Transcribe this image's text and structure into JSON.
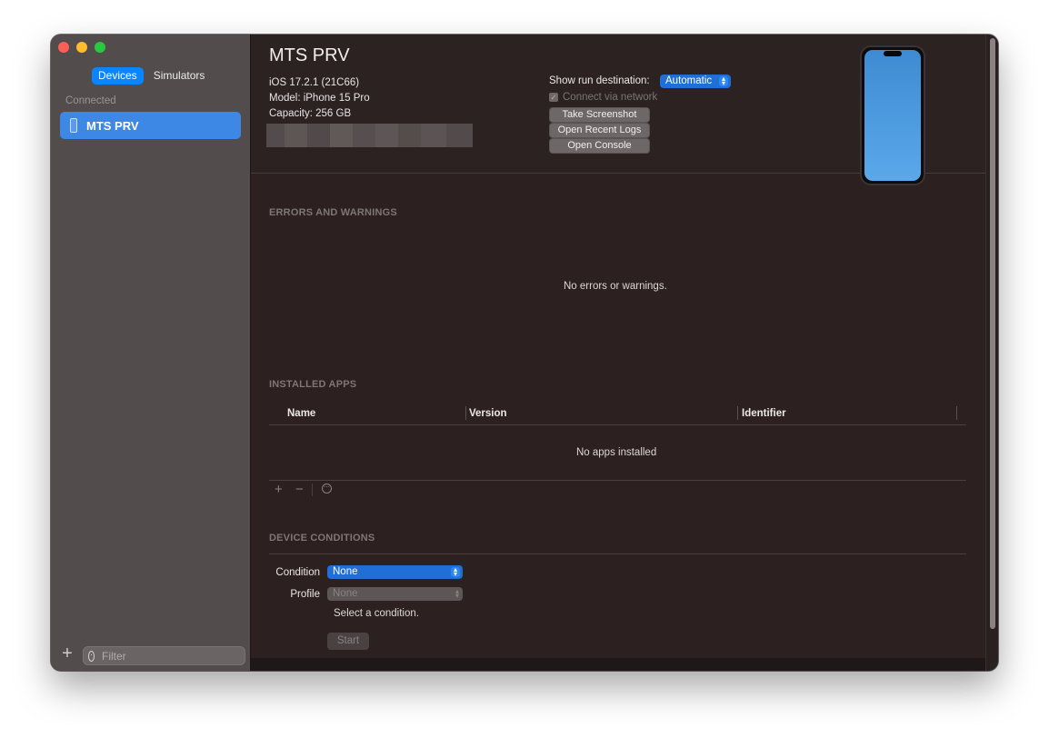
{
  "sidebar": {
    "tabs": [
      {
        "label": "Devices",
        "active": true
      },
      {
        "label": "Simulators",
        "active": false
      }
    ],
    "section_label": "Connected",
    "devices": [
      {
        "name": "MTS PRV",
        "icon": "iphone-icon",
        "selected": true
      }
    ],
    "filter_placeholder": "Filter"
  },
  "device": {
    "title": "MTS PRV",
    "ios": "iOS 17.2.1 (21C66)",
    "model": "Model: iPhone 15 Pro",
    "capacity": "Capacity: 256 GB"
  },
  "run_destination": {
    "label": "Show run destination:",
    "value": "Automatic",
    "connect_via_network": "Connect via network",
    "connect_checked": true,
    "connect_enabled": false
  },
  "actions": {
    "take_screenshot": "Take Screenshot",
    "open_recent_logs": "Open Recent Logs",
    "open_console": "Open Console"
  },
  "errors": {
    "title": "ERRORS AND WARNINGS",
    "empty": "No errors or warnings."
  },
  "apps": {
    "title": "INSTALLED APPS",
    "columns": [
      "Name",
      "Version",
      "Identifier"
    ],
    "empty": "No apps installed",
    "add": "+",
    "remove": "−",
    "more": "⋯"
  },
  "conditions": {
    "title": "DEVICE CONDITIONS",
    "condition_label": "Condition",
    "condition_value": "None",
    "profile_label": "Profile",
    "profile_value": "None",
    "hint": "Select a condition.",
    "start": "Start"
  },
  "colors": {
    "accent": "#0a84ff",
    "selection": "#3d87e5",
    "sidebar_bg": "#534c4c",
    "content_bg": "#2c2020"
  }
}
